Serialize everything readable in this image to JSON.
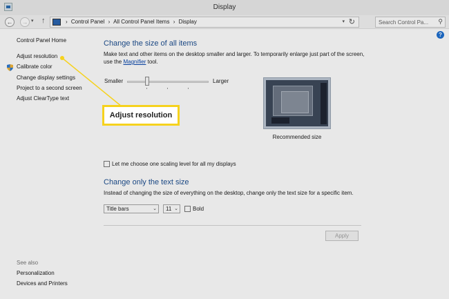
{
  "window": {
    "title": "Display"
  },
  "address": {
    "crumbs": [
      "Control Panel",
      "All Control Panel Items",
      "Display"
    ],
    "search_placeholder": "Search Control Pa..."
  },
  "sidebar": {
    "home": "Control Panel Home",
    "links": [
      "Adjust resolution",
      "Calibrate color",
      "Change display settings",
      "Project to a second screen",
      "Adjust ClearType text"
    ],
    "see_also_title": "See also",
    "see_also": [
      "Personalization",
      "Devices and Printers"
    ]
  },
  "main": {
    "size_heading": "Change the size of all items",
    "size_desc_1": "Make text and other items on the desktop smaller and larger. To temporarily enlarge just part of the screen,",
    "size_desc_2_pre": "use the",
    "magnifier_link": "Magnifier",
    "size_desc_2_post": "tool.",
    "slider": {
      "min_label": "Smaller",
      "max_label": "Larger",
      "level": 0
    },
    "preview_caption": "Recommended size",
    "scaling_checkbox": {
      "label": "Let me choose one scaling level for all my displays",
      "checked": false
    },
    "text_heading": "Change only the text size",
    "text_desc": "Instead of changing the size of everything on the desktop, change only the text size for a specific item.",
    "item_select": "Title bars",
    "size_select": "11",
    "bold": {
      "label": "Bold",
      "checked": false
    },
    "apply_label": "Apply"
  },
  "callout": {
    "label": "Adjust resolution",
    "color": "#f6d21d"
  }
}
